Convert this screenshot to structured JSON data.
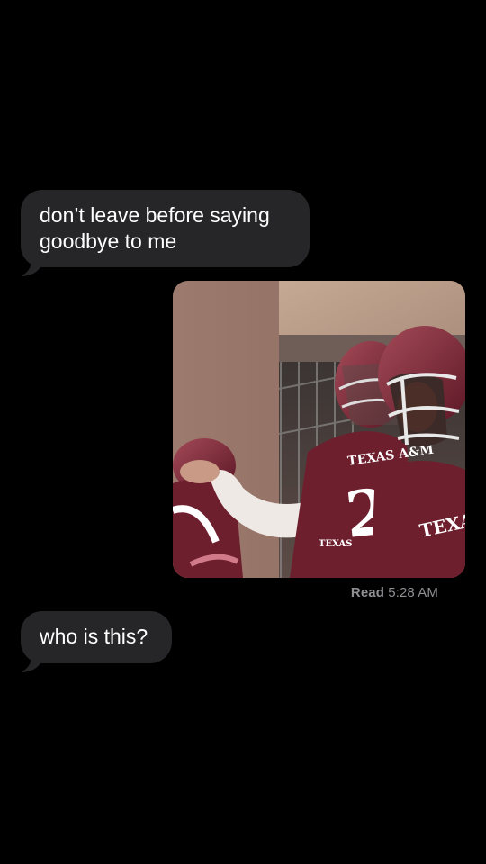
{
  "conversation": {
    "messages": [
      {
        "direction": "incoming",
        "type": "text",
        "lines": [
          "don’t leave before saying",
          "goodbye to me"
        ]
      },
      {
        "direction": "outgoing",
        "type": "image",
        "image_subject": "football-players-photo",
        "jersey_text": "TEXAS A&M",
        "jersey_number": "2",
        "jersey_text_small": "TEXAS",
        "jersey_text_right": "TEXA"
      },
      {
        "direction": "incoming",
        "type": "text",
        "lines": [
          "who is this?"
        ]
      }
    ],
    "read_receipt": {
      "label": "Read",
      "time": "5:28 AM"
    }
  },
  "colors": {
    "background": "#000000",
    "incoming_bubble": "#262628",
    "text": "#ffffff",
    "receipt": "#8e8e93",
    "jersey_maroon": "#6e1f2e"
  }
}
